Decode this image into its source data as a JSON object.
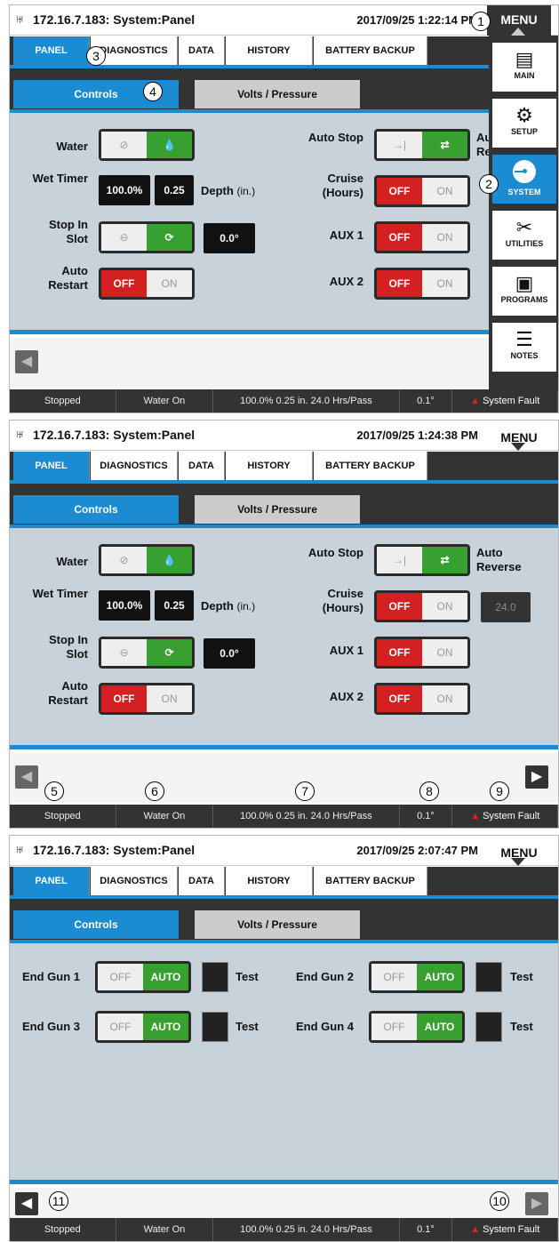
{
  "screens": [
    {
      "title": "172.16.7.183: System:Panel",
      "datetime": "2017/09/25 1:22:14 PM",
      "menu": "MENU",
      "tabs": [
        "PANEL",
        "DIAGNOSTICS",
        "DATA",
        "HISTORY",
        "BATTERY BACKUP"
      ],
      "subtabs": [
        "Controls",
        "Volts / Pressure"
      ],
      "controls": {
        "water": "Water",
        "wet_timer": "Wet Timer",
        "wet_percent": "100.0%",
        "wet_depth": "0.25",
        "depth_label": "Depth",
        "depth_unit": "(in.)",
        "stop_in_slot": "Stop In Slot",
        "slot_value": "0.0°",
        "auto_restart": "Auto Restart",
        "auto_stop": "Auto Stop",
        "auto_reverse": "Auto Reverse",
        "cruise": "Cruise (Hours)",
        "cruise_value": "",
        "aux1": "AUX 1",
        "aux2": "AUX 2",
        "off": "OFF",
        "on": "ON"
      },
      "status": [
        "Stopped",
        "Water On",
        "100.0%  0.25 in.  24.0 Hrs/Pass",
        "0.1°",
        "System Fault"
      ],
      "side_menu": [
        "MAIN",
        "SETUP",
        "SYSTEM",
        "UTILITIES",
        "PROGRAMS",
        "NOTES"
      ],
      "callouts": [
        "1",
        "2",
        "3",
        "4"
      ]
    },
    {
      "title": "172.16.7.183: System:Panel",
      "datetime": "2017/09/25 1:24:38 PM",
      "menu": "MENU",
      "tabs": [
        "PANEL",
        "DIAGNOSTICS",
        "DATA",
        "HISTORY",
        "BATTERY BACKUP"
      ],
      "subtabs": [
        "Controls",
        "Volts / Pressure"
      ],
      "controls": {
        "water": "Water",
        "wet_timer": "Wet Timer",
        "wet_percent": "100.0%",
        "wet_depth": "0.25",
        "depth_label": "Depth",
        "depth_unit": "(in.)",
        "stop_in_slot": "Stop In Slot",
        "slot_value": "0.0°",
        "auto_restart": "Auto Restart",
        "auto_stop": "Auto Stop",
        "auto_reverse": "Auto Reverse",
        "cruise": "Cruise (Hours)",
        "cruise_value": "24.0",
        "aux1": "AUX 1",
        "aux2": "AUX 2",
        "off": "OFF",
        "on": "ON"
      },
      "status": [
        "Stopped",
        "Water On",
        "100.0%  0.25 in.  24.0 Hrs/Pass",
        "0.1°",
        "System Fault"
      ],
      "callouts": [
        "5",
        "6",
        "7",
        "8",
        "9"
      ]
    },
    {
      "title": "172.16.7.183: System:Panel",
      "datetime": "2017/09/25 2:07:47 PM",
      "menu": "MENU",
      "tabs": [
        "PANEL",
        "DIAGNOSTICS",
        "DATA",
        "HISTORY",
        "BATTERY BACKUP"
      ],
      "subtabs": [
        "Controls",
        "Volts / Pressure"
      ],
      "endguns": [
        {
          "label": "End Gun 1",
          "off": "OFF",
          "auto": "AUTO",
          "test": "Test"
        },
        {
          "label": "End Gun 2",
          "off": "OFF",
          "auto": "AUTO",
          "test": "Test"
        },
        {
          "label": "End Gun 3",
          "off": "OFF",
          "auto": "AUTO",
          "test": "Test"
        },
        {
          "label": "End Gun 4",
          "off": "OFF",
          "auto": "AUTO",
          "test": "Test"
        }
      ],
      "status": [
        "Stopped",
        "Water On",
        "100.0%  0.25 in.  24.0 Hrs/Pass",
        "0.1°",
        "System Fault"
      ],
      "callouts": [
        "10",
        "11"
      ]
    }
  ],
  "colors": {
    "accent": "#1b8bd2",
    "active_green": "#38a030",
    "off_red": "#d32020",
    "dark": "#333333",
    "panel_bg": "#c8d2da"
  },
  "icons": {
    "logo": "pivot-logo-icon",
    "main": "main-panel-icon",
    "setup": "gear-icon",
    "system": "system-circle-icon",
    "utilities": "tools-icon",
    "programs": "floppy-disk-icon",
    "notes": "notes-icon",
    "fault": "warning-triangle-icon"
  }
}
